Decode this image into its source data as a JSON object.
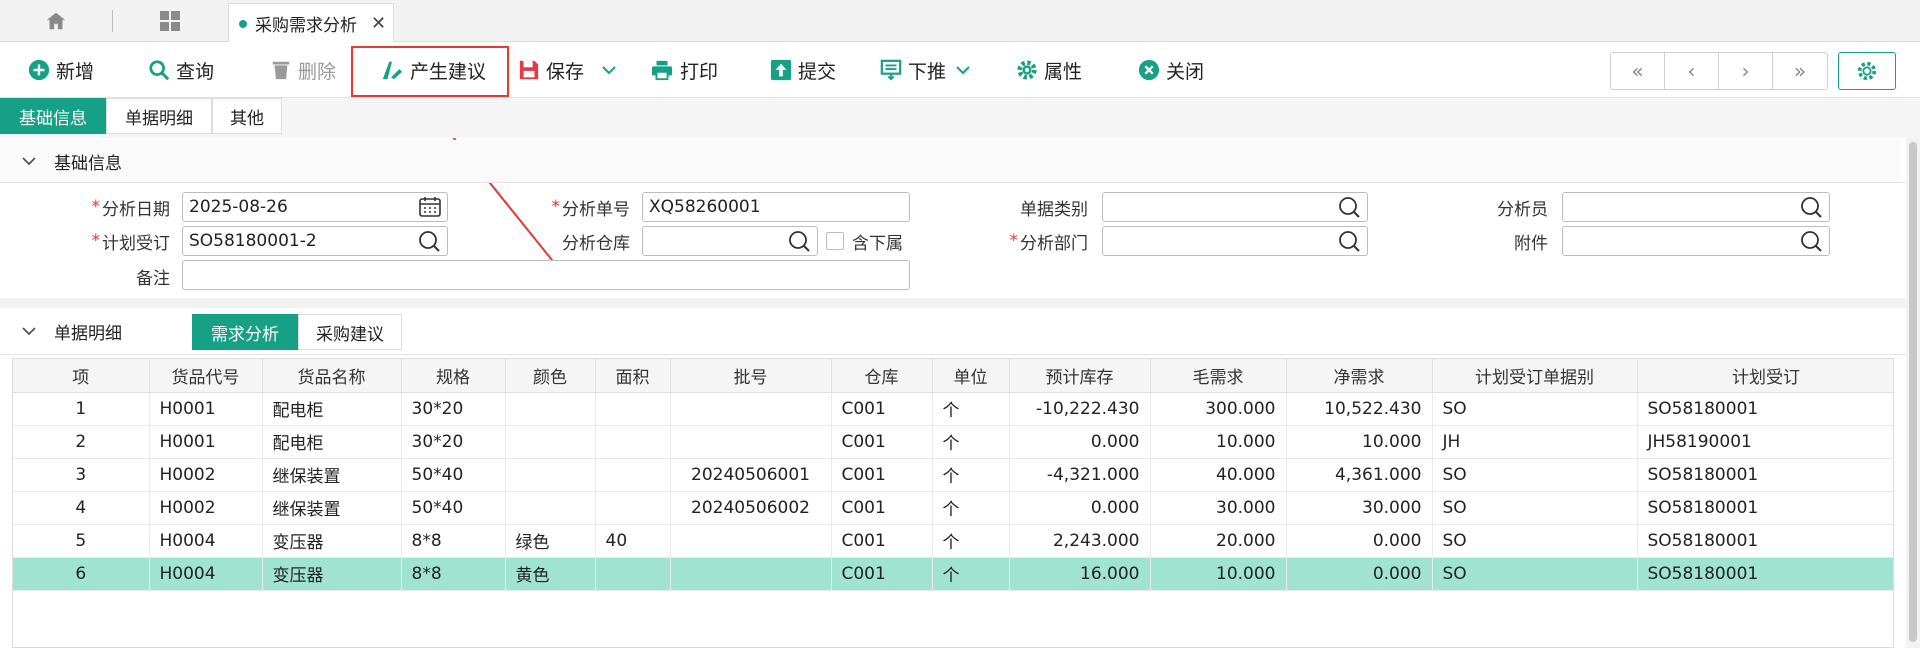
{
  "tabs": {
    "doc_title": "采购需求分析",
    "close_glyph": "✕"
  },
  "toolbar": {
    "new": "新增",
    "query": "查询",
    "delete": "删除",
    "generate": "产生建议",
    "save": "保存",
    "print": "打印",
    "submit": "提交",
    "push": "下推",
    "props": "属性",
    "close": "关闭",
    "nav_first": "«",
    "nav_prev": "‹",
    "nav_next": "›",
    "nav_last": "»"
  },
  "section_tabs": [
    "基础信息",
    "单据明细",
    "其他"
  ],
  "basic": {
    "title": "基础信息",
    "fields": {
      "date_label": "分析日期",
      "date_value": "2025-08-26",
      "plan_label": "计划受订",
      "plan_value": "SO58180001-2",
      "remark_label": "备注",
      "remark_value": "",
      "no_label": "分析单号",
      "no_value": "XQ58260001",
      "wh_label": "分析仓库",
      "wh_value": "",
      "sub_label": "含下属",
      "type_label": "单据类别",
      "type_value": "",
      "dept_label": "分析部门",
      "dept_value": "",
      "analyst_label": "分析员",
      "analyst_value": "",
      "attach_label": "附件",
      "attach_value": ""
    }
  },
  "detail": {
    "title": "单据明细",
    "subtabs": [
      "需求分析",
      "采购建议"
    ],
    "columns": [
      "项",
      "货品代号",
      "货品名称",
      "规格",
      "颜色",
      "面积",
      "批号",
      "仓库",
      "单位",
      "预计库存",
      "毛需求",
      "净需求",
      "计划受订单据别",
      "计划受订"
    ],
    "rows": [
      [
        "1",
        "H0001",
        "配电柜",
        "30*20",
        "",
        "",
        "",
        "C001",
        "个",
        "-10,222.430",
        "300.000",
        "10,522.430",
        "SO",
        "SO58180001"
      ],
      [
        "2",
        "H0001",
        "配电柜",
        "30*20",
        "",
        "",
        "",
        "C001",
        "个",
        "0.000",
        "10.000",
        "10.000",
        "JH",
        "JH58190001"
      ],
      [
        "3",
        "H0002",
        "继保装置",
        "50*40",
        "",
        "",
        "20240506001",
        "C001",
        "个",
        "-4,321.000",
        "40.000",
        "4,361.000",
        "SO",
        "SO58180001"
      ],
      [
        "4",
        "H0002",
        "继保装置",
        "50*40",
        "",
        "",
        "20240506002",
        "C001",
        "个",
        "0.000",
        "30.000",
        "30.000",
        "SO",
        "SO58180001"
      ],
      [
        "5",
        "H0004",
        "变压器",
        "8*8",
        "绿色",
        "40",
        "",
        "C001",
        "个",
        "2,243.000",
        "20.000",
        "0.000",
        "SO",
        "SO58180001"
      ],
      [
        "6",
        "H0004",
        "变压器",
        "8*8",
        "黄色",
        "",
        "",
        "C001",
        "个",
        "16.000",
        "10.000",
        "0.000",
        "SO",
        "SO58180001"
      ]
    ],
    "selected_row": 6
  },
  "colors": {
    "accent": "#16a085",
    "selected_row": "#a0e3d1",
    "annotation": "#e53935"
  }
}
